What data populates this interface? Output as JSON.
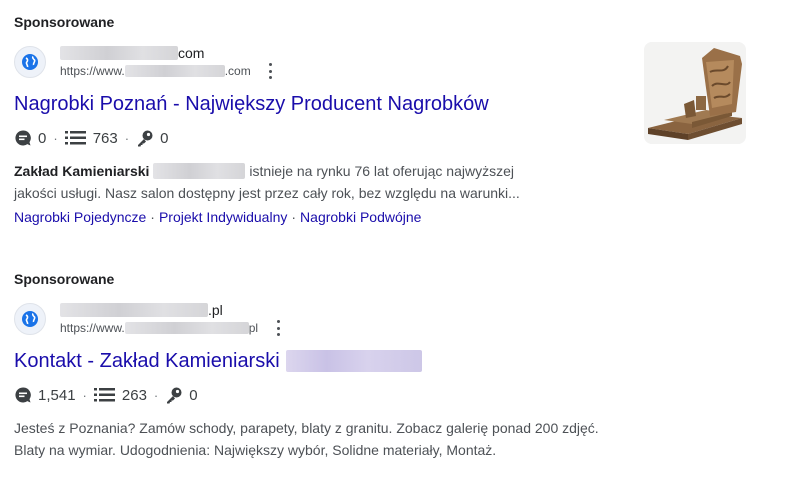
{
  "ad1": {
    "sponsored": "Sponsorowane",
    "site_name_suffix": "com",
    "site_url_prefix": "https://www.",
    "site_url_suffix": ".com",
    "title": "Nagrobki Poznań - Największy Producent Nagrobków",
    "stats": {
      "comments": "0",
      "links": "763",
      "keys": "0"
    },
    "desc_bold": "Zakład Kamieniarski",
    "desc_line1": "istnieje na rynku 76 lat oferując najwyższej",
    "desc_line2": "jakości usługi. Nasz salon dostępny jest przez cały rok, bez względu na warunki...",
    "sitelinks": [
      "Nagrobki Pojedyncze",
      "Projekt Indywidualny",
      "Nagrobki Podwójne"
    ],
    "thumbnail_icon": "tombstone-image"
  },
  "ad2": {
    "sponsored": "Sponsorowane",
    "site_name_suffix": ".pl",
    "site_url_prefix": "https://www.",
    "site_url_suffix": "pl",
    "title": "Kontakt - Zakład Kamieniarski",
    "stats": {
      "comments": "1,541",
      "links": "263",
      "keys": "0"
    },
    "desc_line1": "Jesteś z Poznania? Zamów schody, parapety, blaty z granitu. Zobacz galerię ponad 200 zdjęć.",
    "desc_line2": "Blaty na wymiar. Udogodnienia: Największy wybór, Solidne materiały, Montaż."
  },
  "colors": {
    "link": "#1a0dab",
    "text": "#202124",
    "muted": "#4d5156"
  }
}
